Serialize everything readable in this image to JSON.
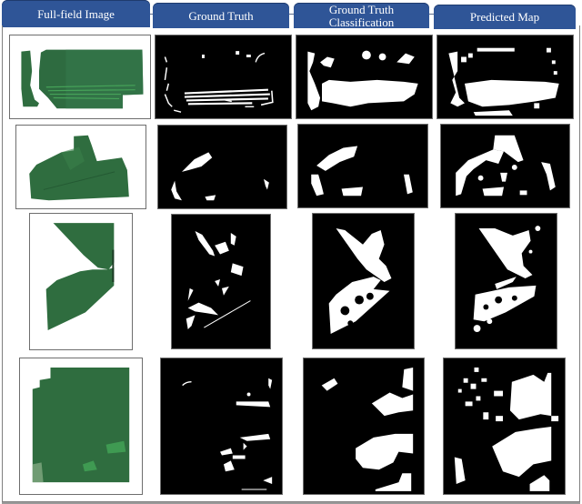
{
  "figure": {
    "columns": [
      {
        "id": "full-field",
        "label": "Full-field Image"
      },
      {
        "id": "ground-truth",
        "label": "Ground Truth"
      },
      {
        "id": "ground-truth-classification",
        "label_line1": "Ground Truth",
        "label_line2": "Classification"
      },
      {
        "id": "predicted-map",
        "label": "Predicted Map"
      }
    ],
    "rows": [
      {
        "id": "field-1",
        "panels": [
          "Full-field Image",
          "Ground Truth",
          "Ground Truth Classification",
          "Predicted Map"
        ]
      },
      {
        "id": "field-2",
        "panels": [
          "Full-field Image",
          "Ground Truth",
          "Ground Truth Classification",
          "Predicted Map"
        ]
      },
      {
        "id": "field-3",
        "panels": [
          "Full-field Image",
          "Ground Truth",
          "Ground Truth Classification",
          "Predicted Map"
        ]
      },
      {
        "id": "field-4",
        "panels": [
          "Full-field Image",
          "Ground Truth",
          "Ground Truth Classification",
          "Predicted Map"
        ]
      }
    ],
    "colors": {
      "header": "#2f5597",
      "header_text": "#ffffff",
      "field_green": "#2e6b3e",
      "field_highlight": "#3f9a52",
      "mask_background": "#000000",
      "mask_foreground": "#ffffff"
    }
  }
}
